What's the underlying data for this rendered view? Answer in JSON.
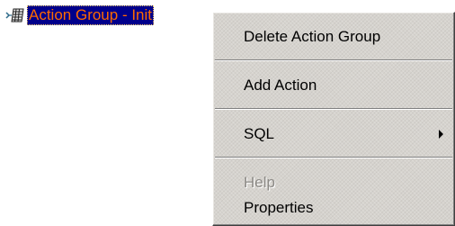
{
  "tree_node": {
    "label": "Action Group - Init",
    "icon": "action-group-icon"
  },
  "context_menu": {
    "items": [
      {
        "label": "Delete Action Group",
        "disabled": false,
        "submenu": false
      },
      {
        "label": "Add Action",
        "disabled": false,
        "submenu": false
      },
      {
        "label": "SQL",
        "disabled": false,
        "submenu": true
      },
      {
        "label": "Help",
        "disabled": true,
        "submenu": false
      },
      {
        "label": "Properties",
        "disabled": false,
        "submenu": false
      }
    ]
  },
  "colors": {
    "selection_background": "#00008b",
    "selection_text": "#ff6a00",
    "menu_background": "#d6d3ce",
    "disabled_text": "#8c8a86"
  }
}
